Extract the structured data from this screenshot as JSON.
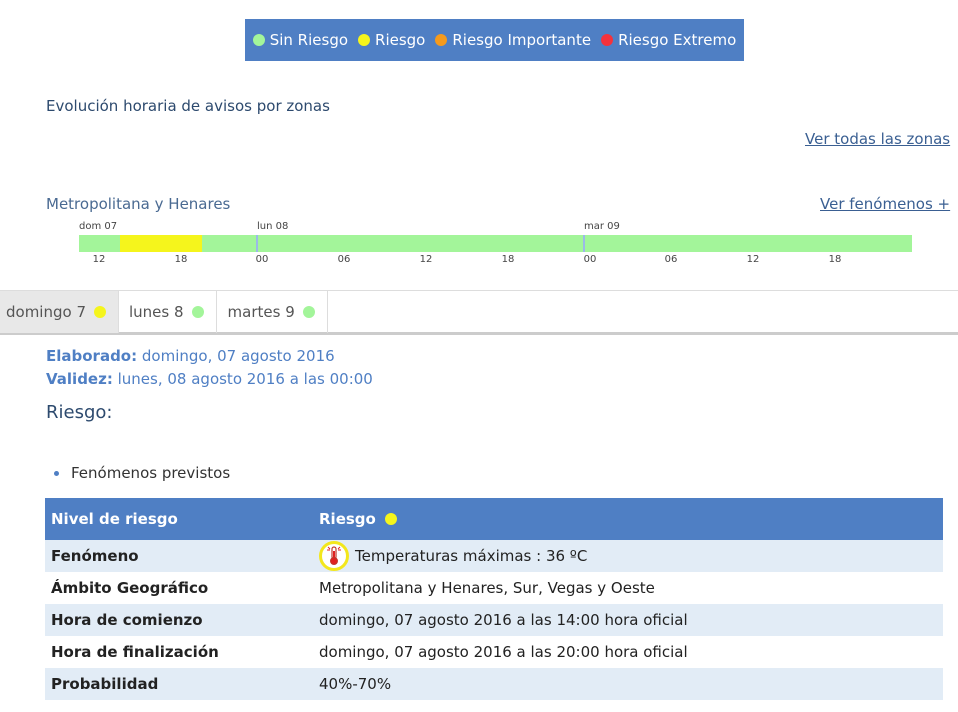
{
  "legend": {
    "items": [
      {
        "label": "Sin Riesgo",
        "color": "#a3f59a"
      },
      {
        "label": "Riesgo",
        "color": "#f5f51c"
      },
      {
        "label": "Riesgo Importante",
        "color": "#f59a1c"
      },
      {
        "label": "Riesgo Extremo",
        "color": "#f5323c"
      }
    ]
  },
  "section_title": "Evolución horaria de avisos por zonas",
  "links": {
    "all_zones": "Ver todas las zonas",
    "phenomena": "Ver fenómenos +"
  },
  "zone": {
    "name": "Metropolitana y Henares",
    "timeline": {
      "days": [
        "dom 07",
        "lun 08",
        "mar 09"
      ],
      "hours": [
        "12",
        "18",
        "00",
        "06",
        "12",
        "18",
        "00",
        "06",
        "12",
        "18"
      ],
      "riesgo_start_hour": "14",
      "riesgo_end_hour": "20"
    }
  },
  "tabs": [
    {
      "label": "domingo 7",
      "dot_color": "#f5f51c",
      "active": true
    },
    {
      "label": "lunes 8",
      "dot_color": "#a3f59a",
      "active": false
    },
    {
      "label": "martes 9",
      "dot_color": "#a3f59a",
      "active": false
    }
  ],
  "meta": {
    "elaborado_label": "Elaborado:",
    "elaborado_value": " domingo, 07 agosto 2016",
    "validez_label": "Validez:",
    "validez_value": " lunes, 08 agosto 2016 a las 00:00"
  },
  "riesgo_heading": "Riesgo:",
  "fenomenos_previstos": "Fenómenos previstos",
  "table": {
    "header": {
      "col1": "Nivel de riesgo",
      "col2": "Riesgo",
      "dot_color": "#f5f51c"
    },
    "rows": [
      {
        "label": "Fenómeno",
        "value": "Temperaturas máximas : 36 ºC"
      },
      {
        "label": "Ámbito Geográfico",
        "value": "Metropolitana y Henares, Sur, Vegas y Oeste"
      },
      {
        "label": "Hora de comienzo",
        "value": "domingo, 07 agosto 2016 a las 14:00 hora oficial"
      },
      {
        "label": "Hora de finalización",
        "value": "domingo, 07 agosto 2016 a las 20:00 hora oficial"
      },
      {
        "label": "Probabilidad",
        "value": "40%-70%"
      }
    ]
  }
}
